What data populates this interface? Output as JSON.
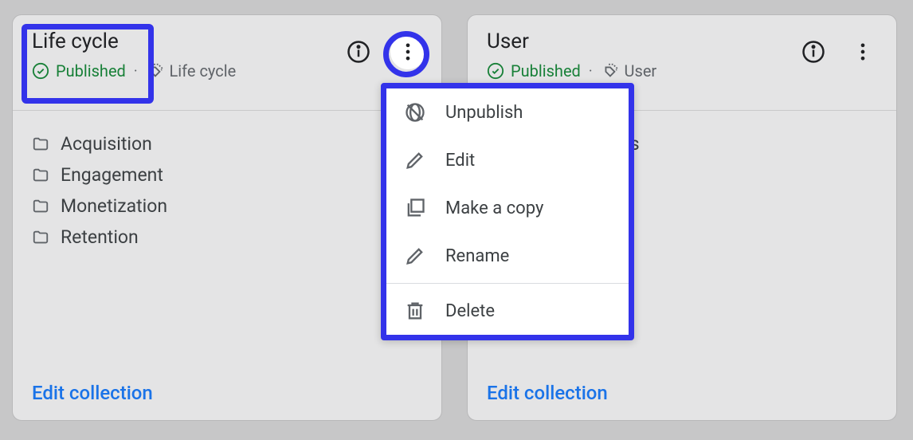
{
  "cards": [
    {
      "title": "Life cycle",
      "status": "Published",
      "tag": "Life cycle",
      "folders": [
        "Acquisition",
        "Engagement",
        "Monetization",
        "Retention"
      ],
      "edit_label": "Edit collection"
    },
    {
      "title": "User",
      "status": "Published",
      "tag": "User",
      "folders": [
        "tes"
      ],
      "edit_label": "Edit collection"
    }
  ],
  "menu": {
    "unpublish": "Unpublish",
    "edit": "Edit",
    "copy": "Make a copy",
    "rename": "Rename",
    "delete": "Delete"
  }
}
